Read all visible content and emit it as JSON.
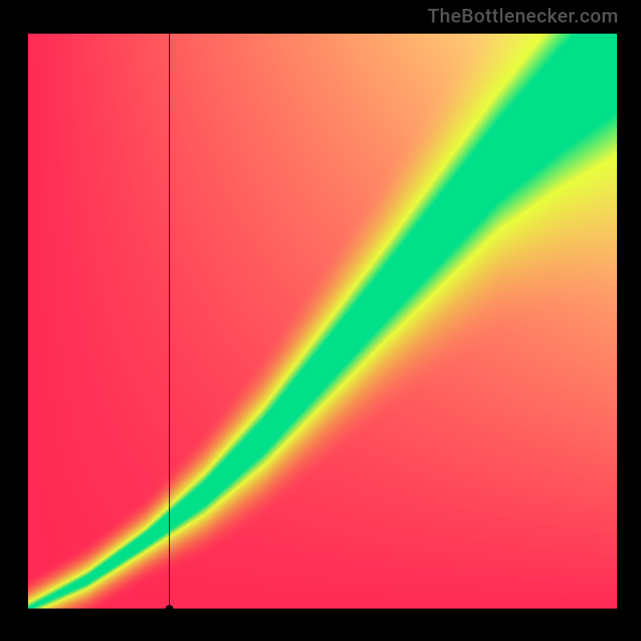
{
  "watermark": "TheBottlenecker.com",
  "chart_data": {
    "type": "heatmap",
    "title": "",
    "xlabel": "",
    "ylabel": "",
    "xlim": [
      0,
      100
    ],
    "ylim": [
      0,
      100
    ],
    "grid": false,
    "colorbar": false,
    "corners": {
      "top_left": "#ff2a55",
      "top_right": "#fffb7b",
      "bottom_left": "#ff2a55",
      "bottom_right": "#ff2a55"
    },
    "ridge": {
      "color": "#00e08a",
      "halo_color": "#e6ff3c",
      "points": [
        {
          "x": 0,
          "y": 0
        },
        {
          "x": 10,
          "y": 5
        },
        {
          "x": 20,
          "y": 12
        },
        {
          "x": 30,
          "y": 20
        },
        {
          "x": 40,
          "y": 30
        },
        {
          "x": 50,
          "y": 42
        },
        {
          "x": 60,
          "y": 54
        },
        {
          "x": 70,
          "y": 66
        },
        {
          "x": 80,
          "y": 78
        },
        {
          "x": 90,
          "y": 88
        },
        {
          "x": 100,
          "y": 97
        }
      ],
      "width": [
        {
          "x": 0,
          "w": 1
        },
        {
          "x": 20,
          "w": 2
        },
        {
          "x": 40,
          "w": 5
        },
        {
          "x": 60,
          "w": 8
        },
        {
          "x": 80,
          "w": 12
        },
        {
          "x": 100,
          "w": 18
        }
      ]
    },
    "marker": {
      "x": 24,
      "y": 0,
      "vline_full_height": true,
      "hline_short": true,
      "dot_radius": 5,
      "color": "#000"
    }
  }
}
